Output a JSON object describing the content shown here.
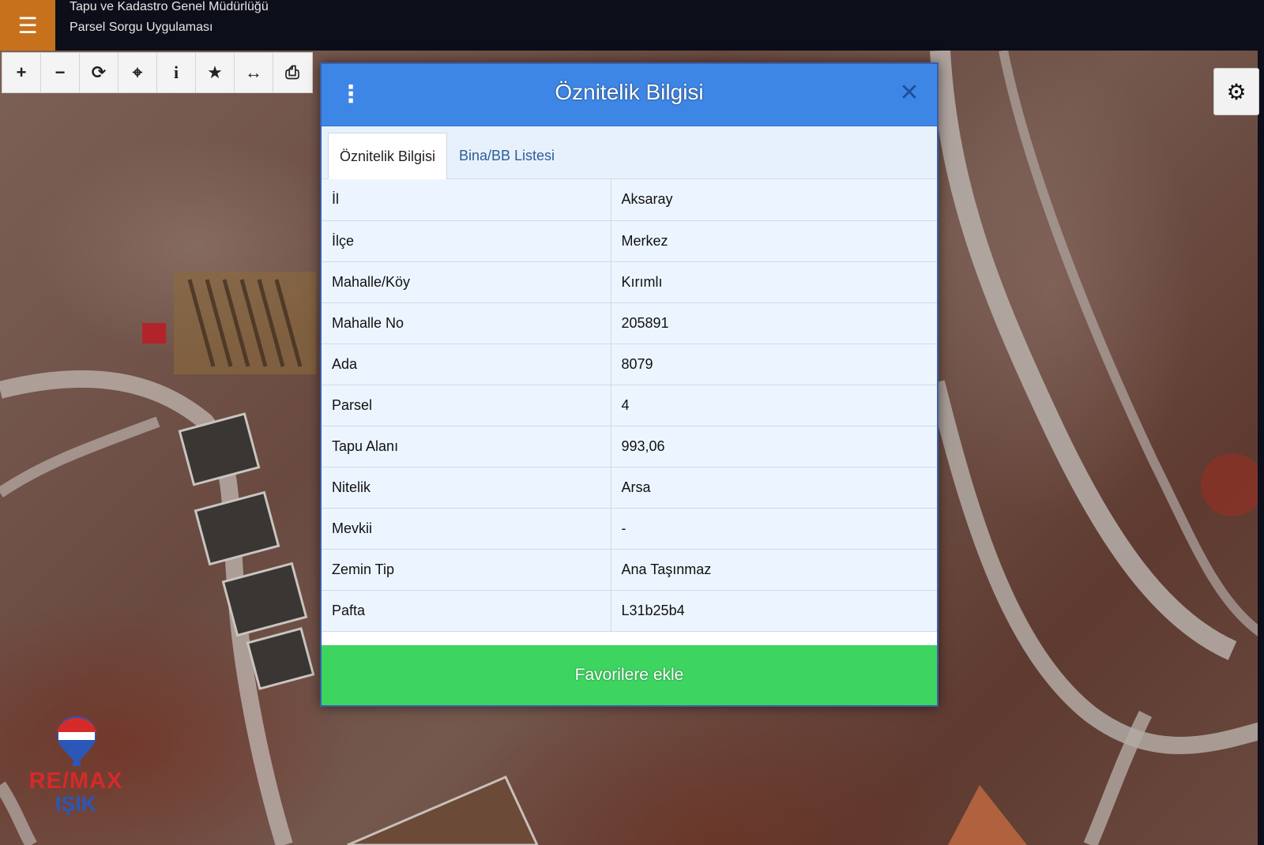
{
  "header": {
    "menu_icon": "hamburger-icon",
    "title_line1": "Tapu ve Kadastro Genel Müdürlüğü",
    "title_line2": "Parsel Sorgu Uygulaması"
  },
  "toolbar": {
    "tools": [
      {
        "name": "zoom-in-icon",
        "glyph": "+"
      },
      {
        "name": "zoom-out-icon",
        "glyph": "−"
      },
      {
        "name": "refresh-icon",
        "glyph": "⟳"
      },
      {
        "name": "crosshair-icon",
        "glyph": "⌖"
      },
      {
        "name": "info-icon",
        "glyph": "i"
      },
      {
        "name": "star-icon",
        "glyph": "★"
      },
      {
        "name": "measure-icon",
        "glyph": "↔"
      },
      {
        "name": "print-icon",
        "glyph": "⎙"
      }
    ]
  },
  "settings": {
    "icon": "gear-icon"
  },
  "dialog": {
    "title": "Öznitelik Bilgisi",
    "close_glyph": "✕",
    "tabs": [
      {
        "label": "Öznitelik Bilgisi",
        "active": true
      },
      {
        "label": "Bina/BB Listesi",
        "active": false
      }
    ],
    "rows": [
      {
        "key": "İl",
        "value": "Aksaray"
      },
      {
        "key": "İlçe",
        "value": "Merkez"
      },
      {
        "key": "Mahalle/Köy",
        "value": "Kırımlı"
      },
      {
        "key": "Mahalle No",
        "value": "205891"
      },
      {
        "key": "Ada",
        "value": "8079"
      },
      {
        "key": "Parsel",
        "value": "4"
      },
      {
        "key": "Tapu Alanı",
        "value": "993,06"
      },
      {
        "key": "Nitelik",
        "value": "Arsa"
      },
      {
        "key": "Mevkii",
        "value": "-"
      },
      {
        "key": "Zemin Tip",
        "value": "Ana Taşınmaz"
      },
      {
        "key": "Pafta",
        "value": "L31b25b4"
      }
    ],
    "favorite_label": "Favorilere ekle"
  },
  "logo": {
    "line1": "RE/MAX",
    "line2": "IŞIK",
    "balloon_text": "RE/MAX"
  },
  "colors": {
    "header_bg": "#0c0e1a",
    "menu_bg": "#c8711c",
    "dialog_header": "#3e86e6",
    "favorite_button": "#3dd460",
    "table_bg": "#ecf5ff"
  }
}
